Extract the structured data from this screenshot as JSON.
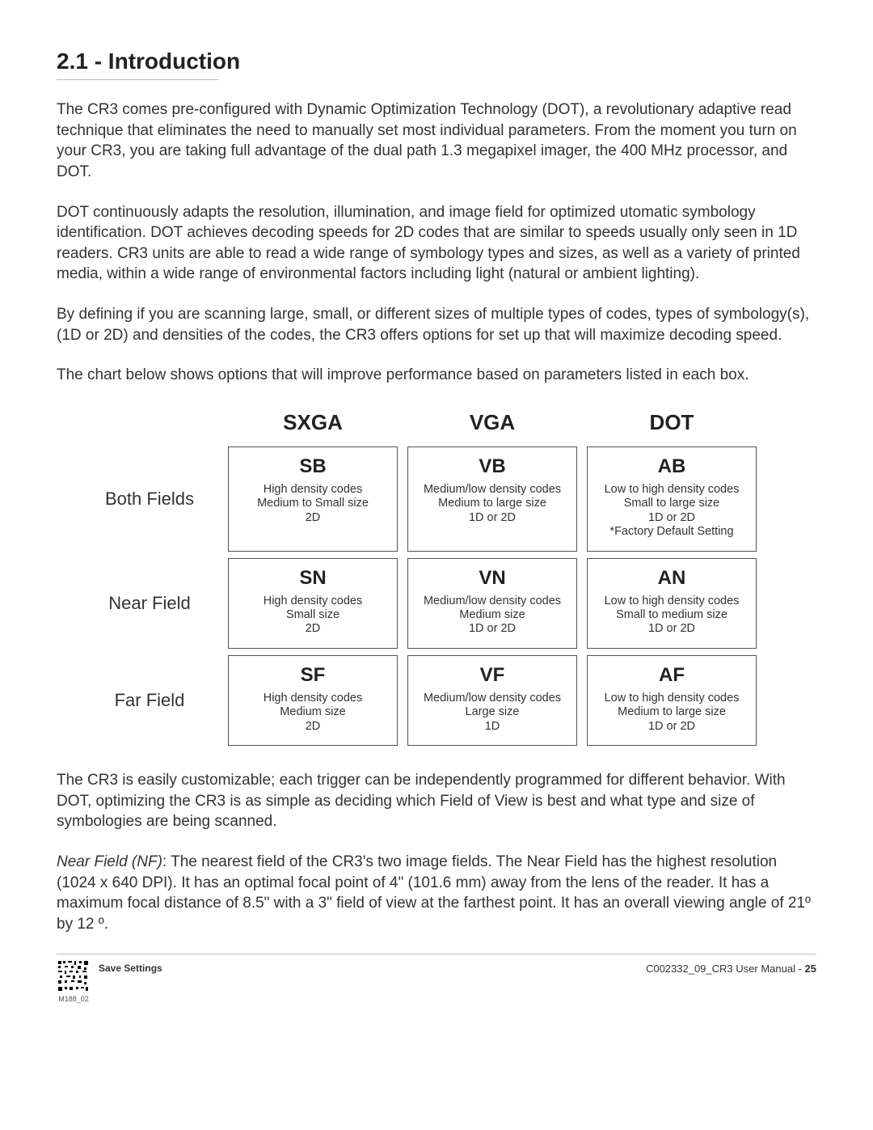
{
  "section": {
    "title": "2.1 - Introduction",
    "p1": "The CR3 comes pre-configured with Dynamic Optimization Technology (DOT), a revolutionary adaptive read technique that eliminates the need to manually set most individual parameters. From the moment you turn on your CR3, you are taking full advantage of the dual path 1.3 megapixel imager, the 400 MHz processor, and DOT.",
    "p2": "DOT continuously adapts the resolution, illumination, and image field for optimized utomatic symbology identification. DOT achieves decoding speeds for 2D codes that are similar to speeds usually only seen in 1D readers. CR3 units are able to read a wide range of symbology types and sizes, as well as a variety of printed media, within a wide range of environmental factors including light (natural or ambient lighting).",
    "p3": "By defining if you are scanning large, small, or different sizes of multiple types of codes, types of symbology(s), (1D or 2D) and  densities of the codes, the CR3 offers options for set up that will maximize decoding speed.",
    "p4": "The chart below shows options that will improve performance based on parameters listed in each box.",
    "p5": "The CR3 is easily customizable; each trigger can be independently programmed for different behavior. With DOT, optimizing the CR3 is as simple as deciding which Field of View is best and what type and size of symbologies are being scanned.",
    "p6_em": "Near Field (NF)",
    "p6_rest": ": The nearest field of the CR3's two image fields. The Near Field has the highest resolution (1024 x 640 DPI). It has an optimal focal point of 4\" (101.6 mm) away from the lens of the reader. It has a maximum focal distance of 8.5\" with a 3\" field of view at the farthest point. It has an overall viewing angle of 21º by 12 º."
  },
  "chart_data": {
    "type": "table",
    "columns": [
      "SXGA",
      "VGA",
      "DOT"
    ],
    "rows": [
      "Both Fields",
      "Near Field",
      "Far Field"
    ],
    "cells": {
      "r0c0": {
        "code": "SB",
        "l1": "High density codes",
        "l2": "Medium to Small size",
        "l3": "2D",
        "l4": ""
      },
      "r0c1": {
        "code": "VB",
        "l1": "Medium/low density codes",
        "l2": "Medium to large size",
        "l3": "1D or 2D",
        "l4": ""
      },
      "r0c2": {
        "code": "AB",
        "l1": "Low to high density codes",
        "l2": "Small to large size",
        "l3": "1D or 2D",
        "l4": "*Factory Default Setting"
      },
      "r1c0": {
        "code": "SN",
        "l1": "High density codes",
        "l2": "Small size",
        "l3": "2D",
        "l4": ""
      },
      "r1c1": {
        "code": "VN",
        "l1": "Medium/low density codes",
        "l2": "Medium size",
        "l3": "1D or 2D",
        "l4": ""
      },
      "r1c2": {
        "code": "AN",
        "l1": "Low to high density codes",
        "l2": "Small to medium size",
        "l3": "1D or 2D",
        "l4": ""
      },
      "r2c0": {
        "code": "SF",
        "l1": "High density codes",
        "l2": "Medium size",
        "l3": "2D",
        "l4": ""
      },
      "r2c1": {
        "code": "VF",
        "l1": "Medium/low density codes",
        "l2": "Large size",
        "l3": "1D",
        "l4": ""
      },
      "r2c2": {
        "code": "AF",
        "l1": "Low to high density codes",
        "l2": "Medium to large size",
        "l3": "1D or 2D",
        "l4": ""
      }
    }
  },
  "footer": {
    "save_label": "Save Settings",
    "qr_label": "M188_02",
    "doc_id": "C002332_09_CR3 User Manual",
    "sep": "   -   ",
    "page": "25"
  }
}
